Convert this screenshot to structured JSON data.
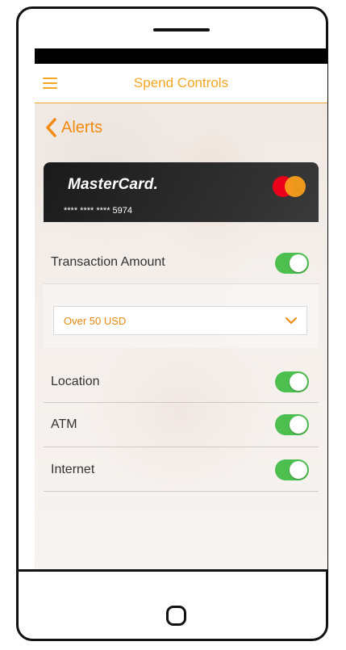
{
  "header": {
    "title": "Spend Controls"
  },
  "nav": {
    "back_label": "Alerts"
  },
  "card": {
    "brand": "MasterCard.",
    "number": "**** **** **** 5974"
  },
  "controls": {
    "transaction_amount": {
      "label": "Transaction Amount",
      "enabled": true
    },
    "threshold": {
      "selected": "Over 50 USD"
    },
    "location": {
      "label": "Location",
      "enabled": true
    },
    "atm": {
      "label": "ATM",
      "enabled": true
    },
    "internet": {
      "label": "Internet",
      "enabled": true
    }
  },
  "colors": {
    "accent": "#f5a623",
    "toggle_on": "#4cbf4f",
    "card_bg": "#1a1a1a"
  },
  "icons": [
    "hamburger-menu-icon",
    "chevron-left-icon",
    "mastercard-logo-icon",
    "chevron-down-icon"
  ]
}
